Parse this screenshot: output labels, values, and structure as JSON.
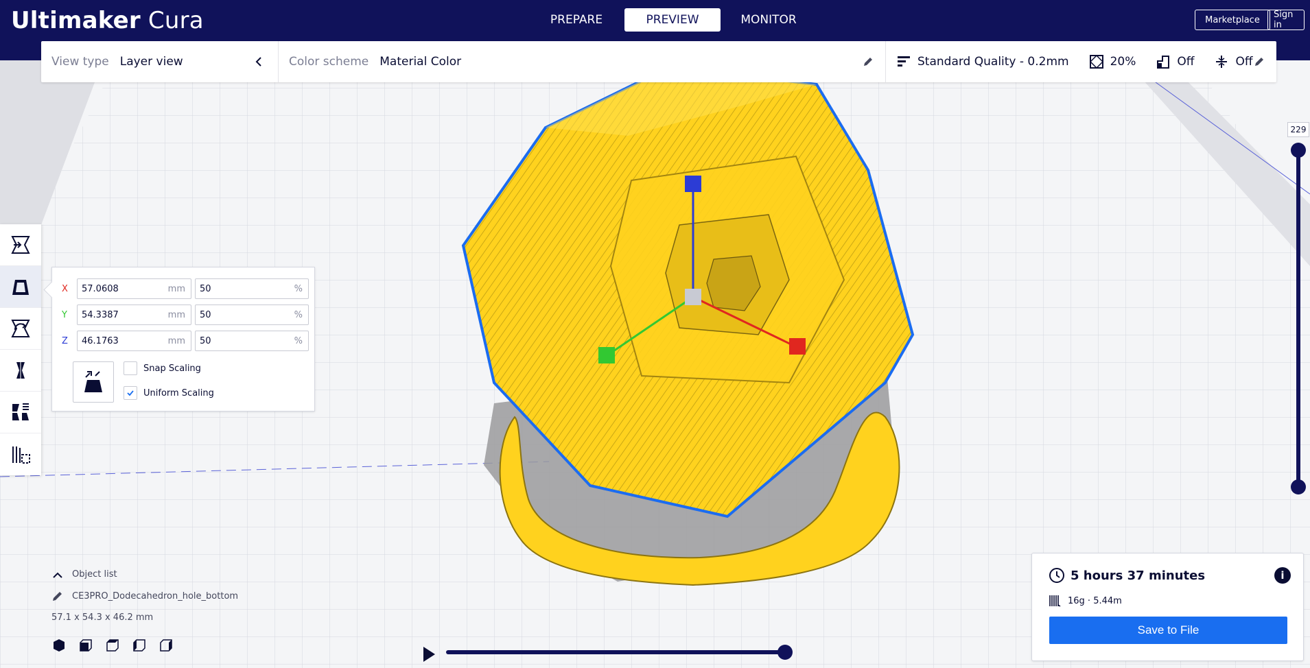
{
  "app": {
    "brand_bold": "Ultimaker",
    "brand_light": "Cura"
  },
  "stages": [
    {
      "label": "PREPARE",
      "active": false
    },
    {
      "label": "PREVIEW",
      "active": true
    },
    {
      "label": "MONITOR",
      "active": false
    }
  ],
  "header": {
    "marketplace": "Marketplace",
    "signin": "Sign in"
  },
  "viewbar": {
    "view_type_label": "View type",
    "view_type_value": "Layer view",
    "color_scheme_label": "Color scheme",
    "color_scheme_value": "Material Color",
    "quality": "Standard Quality - 0.2mm",
    "infill": "20%",
    "support": "Off",
    "adhesion": "Off"
  },
  "scale_tool": {
    "x_label": "X",
    "x_mm": "57.0608",
    "x_pct": "50",
    "y_label": "Y",
    "y_mm": "54.3387",
    "y_pct": "50",
    "z_label": "Z",
    "z_mm": "46.1763",
    "z_pct": "50",
    "unit_mm": "mm",
    "unit_pct": "%",
    "snap_scaling": "Snap Scaling",
    "snap_checked": false,
    "uniform_scaling": "Uniform Scaling",
    "uniform_checked": true
  },
  "object_list": {
    "title": "Object list",
    "object_name": "CE3PRO_Dodecahedron_hole_bottom",
    "dimensions": "57.1 x 54.3 x 46.2 mm"
  },
  "layer_slider": {
    "current_layer": "229",
    "level": 1.0
  },
  "timeline": {
    "progress": 1.0
  },
  "print_info": {
    "time": "5 hours 37 minutes",
    "material": "16g · 5.44m",
    "save_button": "Save to File"
  },
  "colors": {
    "header_bg": "#10125a",
    "accent_blue": "#196ef0",
    "model_yellow": "#ffd21e",
    "model_outline": "#1b6cf0",
    "axis_x": "#e0271f",
    "axis_y": "#32c832",
    "axis_z": "#2c3cd5"
  }
}
